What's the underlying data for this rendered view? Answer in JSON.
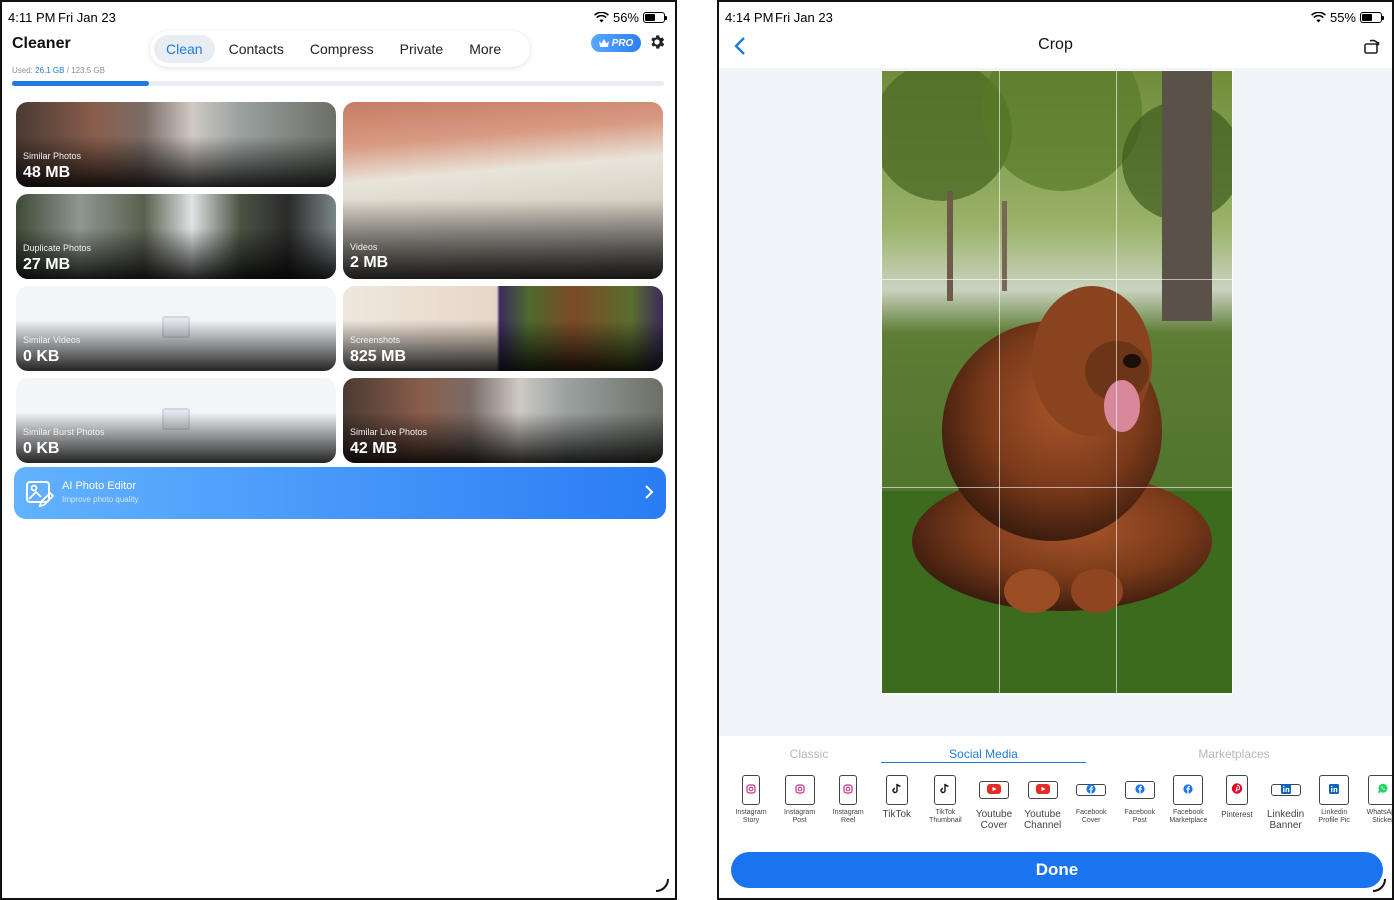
{
  "left": {
    "status": {
      "time": "4:11 PM",
      "date": "Fri Jan 23",
      "battery": "56%",
      "battery_level": 0.56
    },
    "app_title": "Cleaner",
    "tabs": [
      {
        "label": "Clean",
        "active": true
      },
      {
        "label": "Contacts",
        "active": false
      },
      {
        "label": "Compress",
        "active": false
      },
      {
        "label": "Private",
        "active": false
      },
      {
        "label": "More",
        "active": false
      }
    ],
    "pro_label": "PRO",
    "storage": {
      "prefix": "Used: ",
      "used": "26.1 GB",
      "separator": " / ",
      "total": "123.5 GB",
      "fraction": 0.21
    },
    "cards": [
      {
        "label": "Similar Photos",
        "size": "48 MB"
      },
      {
        "label": "Videos",
        "size": "2 MB"
      },
      {
        "label": "Duplicate Photos",
        "size": "27 MB"
      },
      {
        "label": "Similar Videos",
        "size": "0 KB"
      },
      {
        "label": "Screenshots",
        "size": "825 MB"
      },
      {
        "label": "Similar Burst Photos",
        "size": "0 KB"
      },
      {
        "label": "Similar Live Photos",
        "size": "42 MB"
      }
    ],
    "ai_editor": {
      "title": "AI Photo Editor",
      "subtitle": "Improve photo quality"
    },
    "accent": "#1f7ae0"
  },
  "right": {
    "status": {
      "time": "4:14 PM",
      "date": "Fri Jan 23",
      "battery": "55%",
      "battery_level": 0.55
    },
    "title": "Crop",
    "categories": [
      {
        "label": "Classic",
        "active": false
      },
      {
        "label": "Social Media",
        "active": true
      },
      {
        "label": "Marketplaces",
        "active": false
      }
    ],
    "presets": [
      {
        "label": "Instagram\nStory",
        "icon": "instagram-icon"
      },
      {
        "label": "Instagram\nPost",
        "icon": "instagram-icon"
      },
      {
        "label": "Instagram\nReel",
        "icon": "instagram-icon"
      },
      {
        "label": "TikTok",
        "icon": "tiktok-icon"
      },
      {
        "label": "TikTok\nThumbnail",
        "icon": "tiktok-icon"
      },
      {
        "label": "Youtube\nCover",
        "icon": "youtube-icon"
      },
      {
        "label": "Youtube\nChannel",
        "icon": "youtube-icon"
      },
      {
        "label": "Facebook\nCover",
        "icon": "facebook-icon"
      },
      {
        "label": "Facebook\nPost",
        "icon": "facebook-icon"
      },
      {
        "label": "Facebook\nMarketplace",
        "icon": "facebook-icon"
      },
      {
        "label": "Pinterest",
        "icon": "pinterest-icon"
      },
      {
        "label": "Linkedin\nBanner",
        "icon": "linkedin-icon"
      },
      {
        "label": "Linkedin\nProfile Pic",
        "icon": "linkedin-icon"
      },
      {
        "label": "WhatsApp\nSticker",
        "icon": "whatsapp-icon"
      }
    ],
    "done_label": "Done",
    "accent": "#1b74ef"
  }
}
